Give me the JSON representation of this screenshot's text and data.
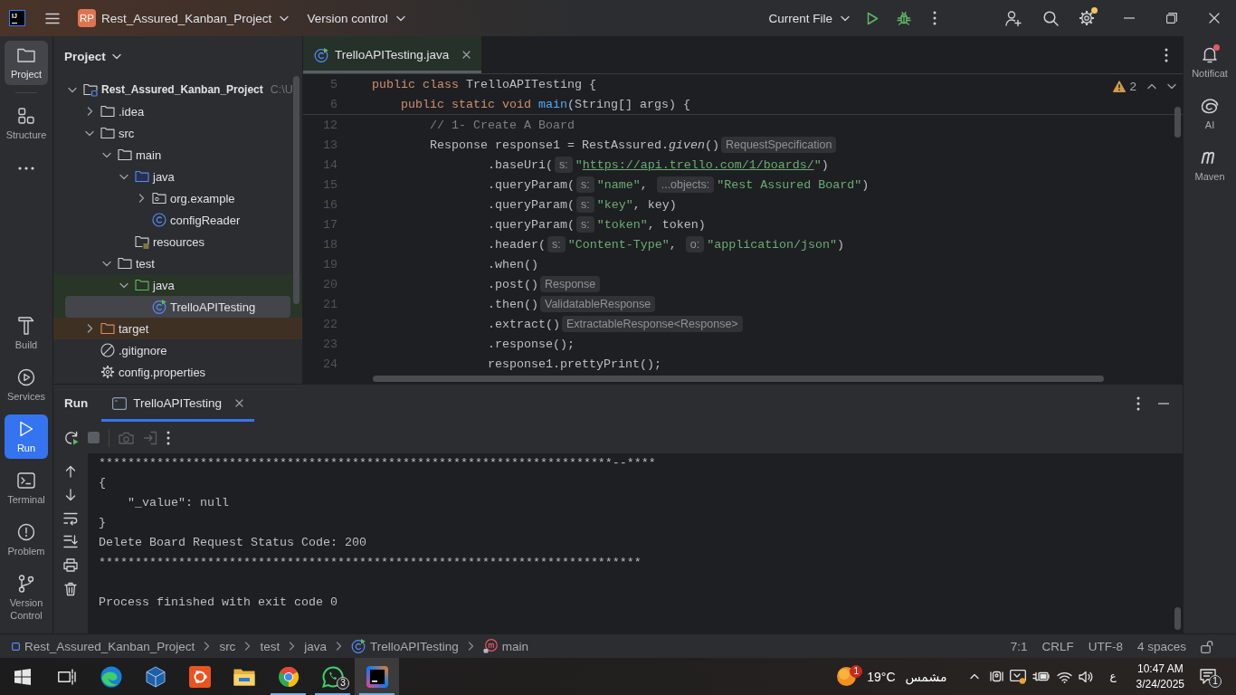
{
  "title_bar": {
    "logo": "IJ",
    "project": {
      "badge": "RP",
      "name": "Rest_Assured_Kanban_Project"
    },
    "vcs": "Version control",
    "run_config": "Current File",
    "settings_badge": true
  },
  "left_toolbar": {
    "top": [
      {
        "kind": "project",
        "label": "Project",
        "selected": true
      },
      {
        "kind": "structure",
        "label": "Structure",
        "selected": false
      },
      {
        "kind": "more",
        "selected": false
      }
    ],
    "bottom": [
      {
        "kind": "build",
        "label": "Build",
        "selected": false
      },
      {
        "kind": "services",
        "label": "Services",
        "selected": false
      },
      {
        "kind": "run",
        "label": "Run",
        "selected": true
      },
      {
        "kind": "terminal",
        "label": "Terminal",
        "selected": false
      },
      {
        "kind": "problems",
        "label": "Problem",
        "selected": false
      },
      {
        "kind": "vcs",
        "label": "Version Control",
        "selected": false
      }
    ]
  },
  "right_toolbar": [
    {
      "kind": "notifications",
      "label": "Notificat",
      "unread": true
    },
    {
      "kind": "ai",
      "label": "AI"
    },
    {
      "kind": "maven",
      "label": "Maven"
    }
  ],
  "project_panel": {
    "title": "Project",
    "tree": [
      {
        "label": "Rest_Assured_Kanban_Project",
        "path": "C:\\U",
        "kind": "module",
        "expanded": true,
        "selected": false,
        "children": [
          {
            "label": ".idea",
            "kind": "folder",
            "expanded": false,
            "selected": false
          },
          {
            "label": "src",
            "kind": "folder",
            "expanded": true,
            "selected": false,
            "children": [
              {
                "label": "main",
                "kind": "folder",
                "expanded": true,
                "selected": false,
                "children": [
                  {
                    "label": "java",
                    "kind": "source-root",
                    "expanded": true,
                    "selected": false,
                    "children": [
                      {
                        "label": "org.example",
                        "kind": "package",
                        "expanded": false,
                        "selected": false
                      },
                      {
                        "label": "configReader",
                        "kind": "class",
                        "selected": false
                      }
                    ]
                  },
                  {
                    "label": "resources",
                    "kind": "resources-root",
                    "selected": false
                  }
                ]
              },
              {
                "label": "test",
                "kind": "folder",
                "expanded": true,
                "selected": false,
                "children": [
                  {
                    "label": "java",
                    "kind": "test-root",
                    "color": "#283527",
                    "expanded": true,
                    "selected": false,
                    "children": [
                      {
                        "label": "TrelloAPITesting",
                        "kind": "runnable-class",
                        "color": "#283527",
                        "selected": true
                      }
                    ]
                  }
                ]
              }
            ]
          },
          {
            "label": "target",
            "kind": "excluded-root",
            "color": "#3e3124",
            "expanded": false,
            "selected": false
          },
          {
            "label": ".gitignore",
            "kind": "ignore-file",
            "selected": false
          },
          {
            "label": "config.properties",
            "kind": "properties-file",
            "selected": false
          }
        ]
      }
    ]
  },
  "editor": {
    "tabs": [
      {
        "label": "TrelloAPITesting.java",
        "kind": "runnable-class",
        "selected": true
      }
    ],
    "warnings": "2",
    "sticky_lines": [
      {
        "number": "5",
        "segments": [
          {
            "kind": "code",
            "tokens": [
              {
                "text": "public class ",
                "kind": "keyword"
              },
              {
                "text": "TrelloAPITesting {",
                "kind": "plain"
              }
            ]
          }
        ]
      },
      {
        "number": "6",
        "segments": [
          {
            "kind": "code",
            "tokens": [
              {
                "text": "    public static void ",
                "kind": "keyword"
              },
              {
                "text": "main",
                "kind": "declaration"
              },
              {
                "text": "(String[] args) {",
                "kind": "plain"
              }
            ]
          }
        ]
      }
    ],
    "lines": [
      {
        "number": "12",
        "segments": [
          {
            "kind": "code",
            "tokens": [
              {
                "text": "        // 1- Create A Board",
                "kind": "comment"
              }
            ]
          }
        ]
      },
      {
        "number": "13",
        "segments": [
          {
            "kind": "code",
            "tokens": [
              {
                "text": "        Response response1 = RestAssured.",
                "kind": "plain"
              },
              {
                "text": "given",
                "kind": "static-call"
              },
              {
                "text": "()",
                "kind": "plain"
              }
            ]
          },
          {
            "kind": "hint",
            "text": "RequestSpecification"
          }
        ]
      },
      {
        "number": "14",
        "segments": [
          {
            "kind": "code",
            "tokens": [
              {
                "text": "                .baseUri(",
                "kind": "plain"
              }
            ]
          },
          {
            "kind": "hint",
            "text": "s:"
          },
          {
            "kind": "code",
            "tokens": [
              {
                "text": "\"",
                "kind": "string"
              },
              {
                "text": "https://api.trello.com/1/boards/",
                "kind": "link"
              },
              {
                "text": "\"",
                "kind": "string"
              },
              {
                "text": ")",
                "kind": "plain"
              }
            ]
          }
        ]
      },
      {
        "number": "15",
        "segments": [
          {
            "kind": "code",
            "tokens": [
              {
                "text": "                .queryParam(",
                "kind": "plain"
              }
            ]
          },
          {
            "kind": "hint",
            "text": "s:"
          },
          {
            "kind": "code",
            "tokens": [
              {
                "text": "\"name\"",
                "kind": "string"
              },
              {
                "text": ", ",
                "kind": "plain"
              }
            ]
          },
          {
            "kind": "hint",
            "text": "...objects:"
          },
          {
            "kind": "code",
            "tokens": [
              {
                "text": "\"Rest Assured Board\"",
                "kind": "string"
              },
              {
                "text": ")",
                "kind": "plain"
              }
            ]
          }
        ]
      },
      {
        "number": "16",
        "segments": [
          {
            "kind": "code",
            "tokens": [
              {
                "text": "                .queryParam(",
                "kind": "plain"
              }
            ]
          },
          {
            "kind": "hint",
            "text": "s:"
          },
          {
            "kind": "code",
            "tokens": [
              {
                "text": "\"key\"",
                "kind": "string"
              },
              {
                "text": ", key)",
                "kind": "plain"
              }
            ]
          }
        ]
      },
      {
        "number": "17",
        "segments": [
          {
            "kind": "code",
            "tokens": [
              {
                "text": "                .queryParam(",
                "kind": "plain"
              }
            ]
          },
          {
            "kind": "hint",
            "text": "s:"
          },
          {
            "kind": "code",
            "tokens": [
              {
                "text": "\"token\"",
                "kind": "string"
              },
              {
                "text": ", token)",
                "kind": "plain"
              }
            ]
          }
        ]
      },
      {
        "number": "18",
        "segments": [
          {
            "kind": "code",
            "tokens": [
              {
                "text": "                .header(",
                "kind": "plain"
              }
            ]
          },
          {
            "kind": "hint",
            "text": "s:"
          },
          {
            "kind": "code",
            "tokens": [
              {
                "text": "\"Content-Type\"",
                "kind": "string"
              },
              {
                "text": ", ",
                "kind": "plain"
              }
            ]
          },
          {
            "kind": "hint",
            "text": "o:"
          },
          {
            "kind": "code",
            "tokens": [
              {
                "text": "\"application/json\"",
                "kind": "string"
              },
              {
                "text": ")",
                "kind": "plain"
              }
            ]
          }
        ]
      },
      {
        "number": "19",
        "segments": [
          {
            "kind": "code",
            "tokens": [
              {
                "text": "                .when()",
                "kind": "plain"
              }
            ]
          }
        ]
      },
      {
        "number": "20",
        "segments": [
          {
            "kind": "code",
            "tokens": [
              {
                "text": "                .post()",
                "kind": "plain"
              }
            ]
          },
          {
            "kind": "hint",
            "text": "Response"
          }
        ]
      },
      {
        "number": "21",
        "segments": [
          {
            "kind": "code",
            "tokens": [
              {
                "text": "                .then()",
                "kind": "plain"
              }
            ]
          },
          {
            "kind": "hint",
            "text": "ValidatableResponse"
          }
        ]
      },
      {
        "number": "22",
        "segments": [
          {
            "kind": "code",
            "tokens": [
              {
                "text": "                .extract()",
                "kind": "plain"
              }
            ]
          },
          {
            "kind": "hint",
            "text": "ExtractableResponse<Response>"
          }
        ]
      },
      {
        "number": "23",
        "segments": [
          {
            "kind": "code",
            "tokens": [
              {
                "text": "                .response();",
                "kind": "plain"
              }
            ]
          }
        ]
      },
      {
        "number": "24",
        "segments": [
          {
            "kind": "code",
            "tokens": [
              {
                "text": "                response1.prettyPrint();",
                "kind": "plain"
              }
            ]
          }
        ]
      }
    ]
  },
  "run_panel": {
    "title": "Run",
    "tabs": [
      {
        "label": "TrelloAPITesting",
        "selected": true
      }
    ],
    "toolbar": [
      {
        "kind": "rerun",
        "disabled": false
      },
      {
        "kind": "stop",
        "disabled": true
      },
      {
        "kind": "separator"
      },
      {
        "kind": "screenshot",
        "disabled": true
      },
      {
        "kind": "exit",
        "disabled": true
      },
      {
        "kind": "more",
        "disabled": false
      }
    ],
    "output": [
      "***********************************************************************--****",
      "{",
      "    \"_value\": null",
      "}",
      "Delete Board Request Status Code: 200",
      "***************************************************************************"
    ],
    "exit_message": "Process finished with exit code 0"
  },
  "status_bar": {
    "breadcrumbs": [
      {
        "label": "Rest_Assured_Kanban_Project",
        "kind": "module"
      },
      {
        "label": "src",
        "kind": "folder"
      },
      {
        "label": "test",
        "kind": "folder"
      },
      {
        "label": "java",
        "kind": "folder"
      },
      {
        "label": "TrelloAPITesting",
        "kind": "runnable-class"
      },
      {
        "label": "main",
        "kind": "method"
      }
    ],
    "widgets": [
      "7:1",
      "CRLF",
      "UTF-8",
      "4 spaces"
    ]
  },
  "taskbar": {
    "apps": [
      {
        "kind": "start",
        "running": false,
        "selected": false
      },
      {
        "kind": "task-view",
        "running": false,
        "selected": false
      },
      {
        "kind": "edge",
        "running": false,
        "selected": false
      },
      {
        "kind": "virtualbox",
        "running": false,
        "selected": false
      },
      {
        "kind": "ubuntu",
        "running": false,
        "selected": false
      },
      {
        "kind": "explorer",
        "running": false,
        "selected": false
      },
      {
        "kind": "chrome",
        "running": true,
        "selected": false
      },
      {
        "kind": "whatsapp",
        "running": true,
        "selected": false,
        "badge": "3"
      },
      {
        "kind": "intellij",
        "running": true,
        "selected": true
      }
    ],
    "weather": {
      "badge": "1",
      "temperature": "19°C",
      "condition": "مشمس"
    },
    "language": "ع",
    "time": "10:47 AM",
    "date": "3/24/2025",
    "notifications": "1"
  }
}
